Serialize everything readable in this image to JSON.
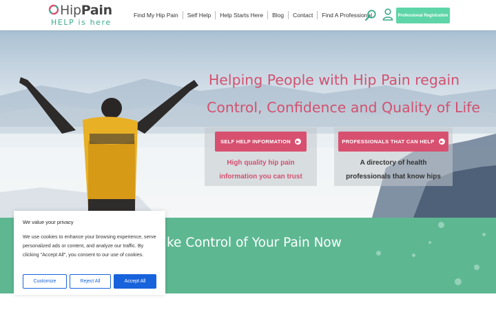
{
  "header": {
    "logo": {
      "name_light": "Hip",
      "name_bold": "Pain",
      "tagline": "HELP is here"
    },
    "nav": [
      {
        "label": "Find My Hip Pain"
      },
      {
        "label": "Self Help"
      },
      {
        "label": "Help Starts Here"
      },
      {
        "label": "Blog"
      },
      {
        "label": "Contact"
      },
      {
        "label": "Find A Professional"
      }
    ],
    "search_icon": "search-icon",
    "user_icon": "user-icon",
    "register_label": "Professional Registration"
  },
  "hero": {
    "title_line1": "Helping People with Hip Pain regain",
    "title_line2": "Control, Confidence and Quality of Life",
    "cards": [
      {
        "button": "SELF HELP INFORMATION",
        "line1": "High quality hip pain",
        "line2": "information you can trust"
      },
      {
        "button": "PROFESSIONALS THAT CAN HELP",
        "line1": "A directory of health",
        "line2": "professionals that know hips"
      }
    ]
  },
  "banner": {
    "text": "ke Control of Your Pain Now"
  },
  "cookie": {
    "title": "We value your privacy",
    "body": "We use cookies to enhance your browsing experience, serve personalized ads or content, and analyze our traffic. By clicking \"Accept All\", you consent to our use of cookies.",
    "customize": "Customize",
    "reject": "Reject All",
    "accept": "Accept All"
  },
  "colors": {
    "brand_pink": "#d85070",
    "brand_green": "#5db892",
    "register_green": "#5ed5a6",
    "cookie_blue": "#1863dc"
  }
}
